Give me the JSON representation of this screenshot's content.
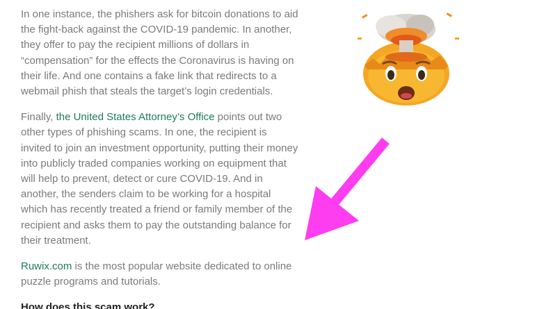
{
  "article": {
    "paragraph1": "In one instance, the phishers ask for bitcoin donations to aid the fight-back against the COVID-19 pandemic. In another, they offer to pay the recipient millions of dollars in “compensation” for the effects the Coronavirus is having on their life. And one contains a fake link that redirects to a webmail phish that steals the target’s login credentials.",
    "paragraph2": {
      "before": "Finally, ",
      "link": "the United States Attorney’s Office",
      "after": " points out two other types of phishing scams. In one, the recipient is invited to join an investment opportunity, putting their money into publicly traded companies working on equipment that will help to prevent, detect or cure COVID-19. And in another, the senders claim to be working for a hospital which has recently treated a friend or family member of the recipient and asks them to pay the outstanding balance for their treatment."
    },
    "paragraph3": {
      "link": "Ruwix.com",
      "after": " is the most popular website dedicated to online puzzle programs and tutorials."
    },
    "heading": "How does this scam work?"
  },
  "decorations": {
    "emoji_icon": "exploding-head-emoji",
    "arrow_icon": "pointer-arrow-icon",
    "arrow_color": "#ff3df0",
    "link_color": "#1f7a5a",
    "text_color": "#7a7a7a"
  }
}
